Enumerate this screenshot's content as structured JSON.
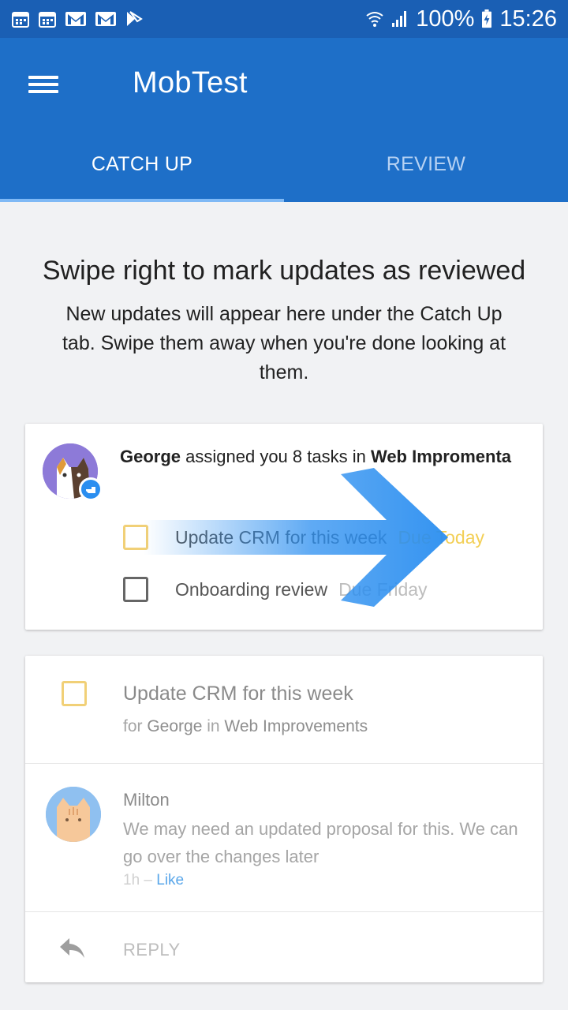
{
  "status_bar": {
    "battery": "100%",
    "time": "15:26",
    "icons": [
      "calendar-icon",
      "calendar-icon",
      "gmail-icon",
      "gmail-icon",
      "play-store-icon",
      "wifi-icon",
      "signal-icon",
      "battery-charging-icon"
    ]
  },
  "app_bar": {
    "title": "MobTest",
    "menu_icon": "hamburger-menu-icon"
  },
  "tabs": [
    {
      "label": "CATCH UP",
      "active": true
    },
    {
      "label": "REVIEW",
      "active": false
    }
  ],
  "intro": {
    "title": "Swipe right to mark updates as reviewed",
    "body": "New updates will appear here under the Catch Up tab. Swipe them away when you're done looking at them."
  },
  "card1": {
    "user": "George",
    "action": " assigned you 8 tasks in ",
    "project": "Web Impromenta",
    "tasks": [
      {
        "label": "Update CRM for this week",
        "due": "Due Today"
      },
      {
        "label": "Onboarding review",
        "due": "Due Friday"
      }
    ]
  },
  "card2": {
    "task_title": "Update CRM for this week",
    "sub_prefix": "for ",
    "sub_user": "George",
    "sub_mid": " in ",
    "sub_project": "Web Improvements",
    "comment": {
      "author": "Milton",
      "text": "We may need an updated proposal for this. We can go over the changes later",
      "time": "1h",
      "separator": " – ",
      "like": "Like"
    },
    "reply_label": "REPLY"
  },
  "colors": {
    "status_bar": "#1a5fb4",
    "app_bar": "#1e6fc8",
    "accent_blue": "#2a8ef0",
    "due_today": "#f3cf55"
  }
}
